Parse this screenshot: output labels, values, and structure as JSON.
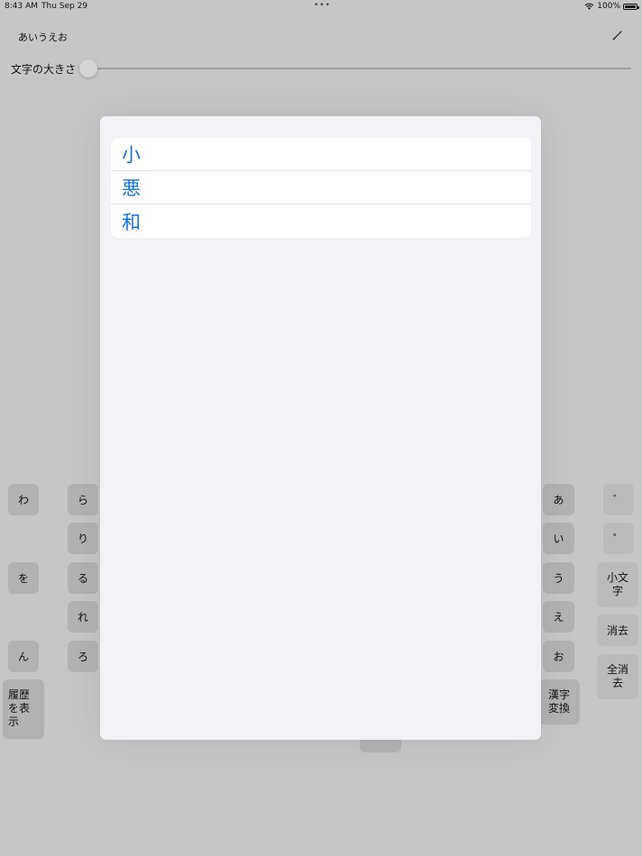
{
  "status_bar": {
    "time": "8:43 AM",
    "date": "Thu Sep 29",
    "dots": "•••",
    "battery_percent": "100%",
    "wifi_icon": "wifi-icon",
    "battery_icon": "battery-icon",
    "battery_level": 1.0
  },
  "input": {
    "text": "あいうえお",
    "edit_icon": "pencil-icon"
  },
  "font_size": {
    "label": "文字の大きさ",
    "slider_value": 0
  },
  "keys": {
    "wa": "わ",
    "wo": "を",
    "n": "ん",
    "ra": "ら",
    "ri": "り",
    "ru": "る",
    "re": "れ",
    "ro": "ろ",
    "a": "あ",
    "i": "い",
    "u": "う",
    "e": "え",
    "o": "お",
    "dakuten": "゛",
    "handakuten": "゜",
    "small_line1": "小文",
    "small_line2": "字",
    "delete": "消去",
    "clear_line1": "全消",
    "clear_line2": "去",
    "history_line1": "履歴",
    "history_line2": "を表",
    "history_line3": "示",
    "kanji_line1": "漢字",
    "kanji_line2": "変換"
  },
  "candidates": [
    "小",
    "悪",
    "和"
  ]
}
